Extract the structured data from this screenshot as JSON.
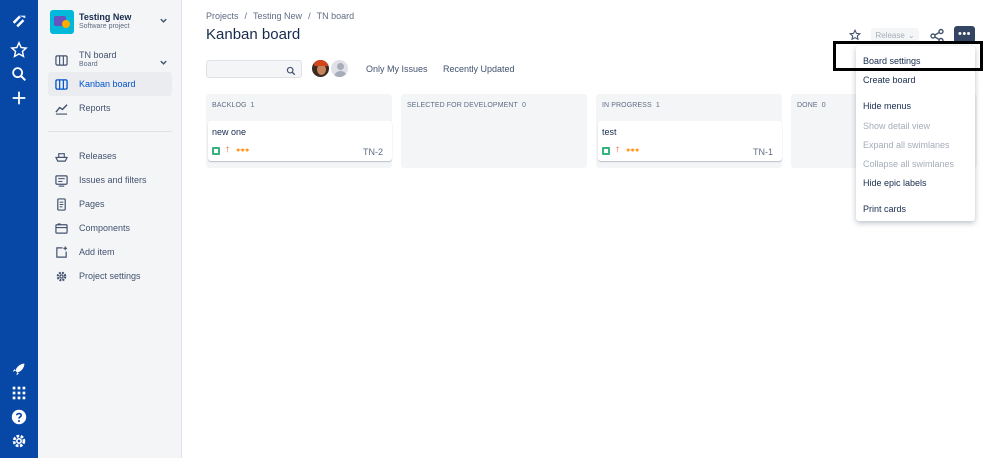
{
  "project": {
    "name": "Testing New",
    "type": "Software project"
  },
  "sidebar": {
    "board_switcher": {
      "name": "TN board",
      "sub": "Board"
    },
    "items": [
      {
        "label": "Kanban board",
        "icon": "kanban-icon",
        "active": true
      },
      {
        "label": "Reports",
        "icon": "chart-icon"
      },
      {
        "label": "Releases",
        "icon": "ship-icon"
      },
      {
        "label": "Issues and filters",
        "icon": "issues-icon"
      },
      {
        "label": "Pages",
        "icon": "page-icon"
      },
      {
        "label": "Components",
        "icon": "component-icon"
      },
      {
        "label": "Add item",
        "icon": "add-item-icon"
      },
      {
        "label": "Project settings",
        "icon": "gear-icon"
      }
    ]
  },
  "breadcrumbs": [
    "Projects",
    "Testing New",
    "TN board"
  ],
  "breadcrumb_sep": "/",
  "page_title": "Kanban board",
  "filters": {
    "only_my_issues": "Only My Issues",
    "recently_updated": "Recently Updated"
  },
  "search": {
    "placeholder": ""
  },
  "columns": [
    {
      "title": "BACKLOG",
      "count": "1",
      "cards": [
        {
          "title": "new one",
          "key": "TN-2"
        }
      ]
    },
    {
      "title": "SELECTED FOR DEVELOPMENT",
      "count": "0",
      "cards": []
    },
    {
      "title": "IN PROGRESS",
      "count": "1",
      "cards": [
        {
          "title": "test",
          "key": "TN-1"
        }
      ]
    },
    {
      "title": "DONE",
      "count": "0",
      "cards": []
    }
  ],
  "actions": {
    "release": "Release",
    "release_chevron": "⌄",
    "more": "•••"
  },
  "menu": {
    "items": [
      {
        "label": "Board settings",
        "disabled": false
      },
      {
        "label": "Create board",
        "disabled": false
      },
      {
        "label": "Hide menus",
        "disabled": false
      },
      {
        "label": "Show detail view",
        "disabled": true
      },
      {
        "label": "Expand all swimlanes",
        "disabled": true
      },
      {
        "label": "Collapse all swimlanes",
        "disabled": true
      },
      {
        "label": "Hide epic labels",
        "disabled": false
      },
      {
        "label": "Print cards",
        "disabled": false
      }
    ]
  },
  "colors": {
    "global_nav": "#0747a6",
    "link_blue": "#0052cc",
    "text": "#172b4d",
    "column_bg": "#f4f5f7",
    "story_green": "#36b37e",
    "priority": "#ff5630"
  }
}
